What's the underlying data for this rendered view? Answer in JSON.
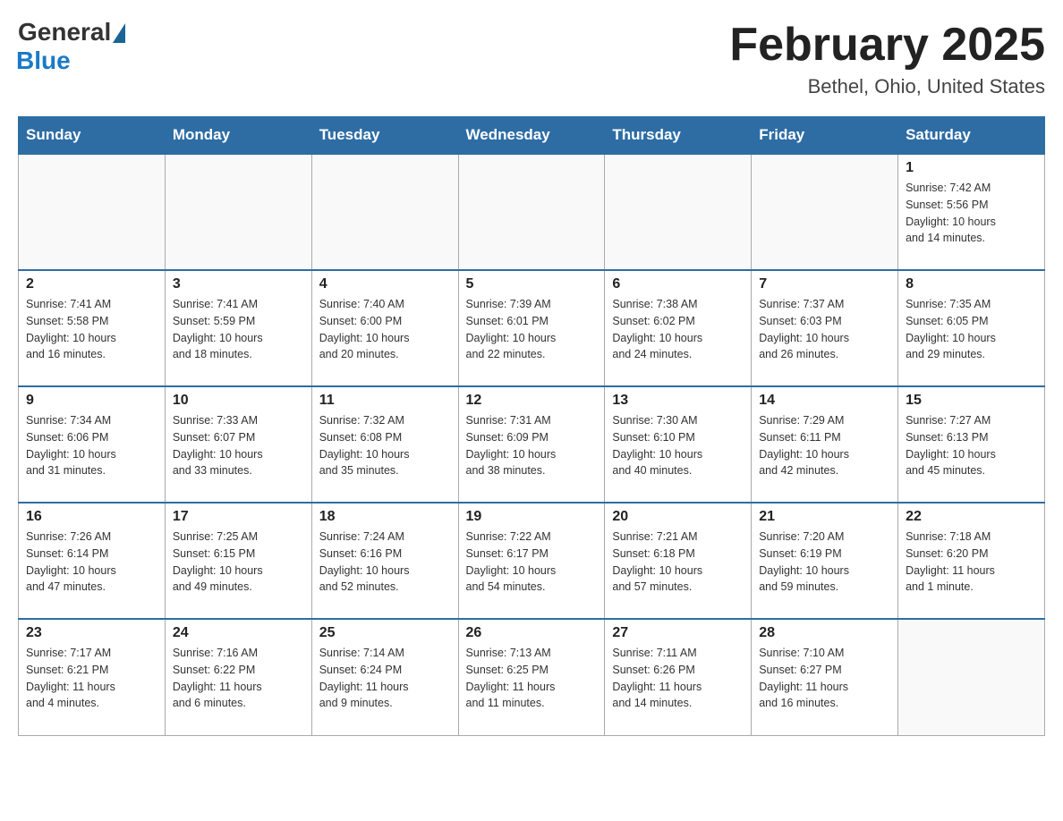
{
  "header": {
    "logo_general": "General",
    "logo_blue": "Blue",
    "month_title": "February 2025",
    "location": "Bethel, Ohio, United States"
  },
  "days_of_week": [
    "Sunday",
    "Monday",
    "Tuesday",
    "Wednesday",
    "Thursday",
    "Friday",
    "Saturday"
  ],
  "weeks": [
    [
      {
        "day": "",
        "info": ""
      },
      {
        "day": "",
        "info": ""
      },
      {
        "day": "",
        "info": ""
      },
      {
        "day": "",
        "info": ""
      },
      {
        "day": "",
        "info": ""
      },
      {
        "day": "",
        "info": ""
      },
      {
        "day": "1",
        "info": "Sunrise: 7:42 AM\nSunset: 5:56 PM\nDaylight: 10 hours\nand 14 minutes."
      }
    ],
    [
      {
        "day": "2",
        "info": "Sunrise: 7:41 AM\nSunset: 5:58 PM\nDaylight: 10 hours\nand 16 minutes."
      },
      {
        "day": "3",
        "info": "Sunrise: 7:41 AM\nSunset: 5:59 PM\nDaylight: 10 hours\nand 18 minutes."
      },
      {
        "day": "4",
        "info": "Sunrise: 7:40 AM\nSunset: 6:00 PM\nDaylight: 10 hours\nand 20 minutes."
      },
      {
        "day": "5",
        "info": "Sunrise: 7:39 AM\nSunset: 6:01 PM\nDaylight: 10 hours\nand 22 minutes."
      },
      {
        "day": "6",
        "info": "Sunrise: 7:38 AM\nSunset: 6:02 PM\nDaylight: 10 hours\nand 24 minutes."
      },
      {
        "day": "7",
        "info": "Sunrise: 7:37 AM\nSunset: 6:03 PM\nDaylight: 10 hours\nand 26 minutes."
      },
      {
        "day": "8",
        "info": "Sunrise: 7:35 AM\nSunset: 6:05 PM\nDaylight: 10 hours\nand 29 minutes."
      }
    ],
    [
      {
        "day": "9",
        "info": "Sunrise: 7:34 AM\nSunset: 6:06 PM\nDaylight: 10 hours\nand 31 minutes."
      },
      {
        "day": "10",
        "info": "Sunrise: 7:33 AM\nSunset: 6:07 PM\nDaylight: 10 hours\nand 33 minutes."
      },
      {
        "day": "11",
        "info": "Sunrise: 7:32 AM\nSunset: 6:08 PM\nDaylight: 10 hours\nand 35 minutes."
      },
      {
        "day": "12",
        "info": "Sunrise: 7:31 AM\nSunset: 6:09 PM\nDaylight: 10 hours\nand 38 minutes."
      },
      {
        "day": "13",
        "info": "Sunrise: 7:30 AM\nSunset: 6:10 PM\nDaylight: 10 hours\nand 40 minutes."
      },
      {
        "day": "14",
        "info": "Sunrise: 7:29 AM\nSunset: 6:11 PM\nDaylight: 10 hours\nand 42 minutes."
      },
      {
        "day": "15",
        "info": "Sunrise: 7:27 AM\nSunset: 6:13 PM\nDaylight: 10 hours\nand 45 minutes."
      }
    ],
    [
      {
        "day": "16",
        "info": "Sunrise: 7:26 AM\nSunset: 6:14 PM\nDaylight: 10 hours\nand 47 minutes."
      },
      {
        "day": "17",
        "info": "Sunrise: 7:25 AM\nSunset: 6:15 PM\nDaylight: 10 hours\nand 49 minutes."
      },
      {
        "day": "18",
        "info": "Sunrise: 7:24 AM\nSunset: 6:16 PM\nDaylight: 10 hours\nand 52 minutes."
      },
      {
        "day": "19",
        "info": "Sunrise: 7:22 AM\nSunset: 6:17 PM\nDaylight: 10 hours\nand 54 minutes."
      },
      {
        "day": "20",
        "info": "Sunrise: 7:21 AM\nSunset: 6:18 PM\nDaylight: 10 hours\nand 57 minutes."
      },
      {
        "day": "21",
        "info": "Sunrise: 7:20 AM\nSunset: 6:19 PM\nDaylight: 10 hours\nand 59 minutes."
      },
      {
        "day": "22",
        "info": "Sunrise: 7:18 AM\nSunset: 6:20 PM\nDaylight: 11 hours\nand 1 minute."
      }
    ],
    [
      {
        "day": "23",
        "info": "Sunrise: 7:17 AM\nSunset: 6:21 PM\nDaylight: 11 hours\nand 4 minutes."
      },
      {
        "day": "24",
        "info": "Sunrise: 7:16 AM\nSunset: 6:22 PM\nDaylight: 11 hours\nand 6 minutes."
      },
      {
        "day": "25",
        "info": "Sunrise: 7:14 AM\nSunset: 6:24 PM\nDaylight: 11 hours\nand 9 minutes."
      },
      {
        "day": "26",
        "info": "Sunrise: 7:13 AM\nSunset: 6:25 PM\nDaylight: 11 hours\nand 11 minutes."
      },
      {
        "day": "27",
        "info": "Sunrise: 7:11 AM\nSunset: 6:26 PM\nDaylight: 11 hours\nand 14 minutes."
      },
      {
        "day": "28",
        "info": "Sunrise: 7:10 AM\nSunset: 6:27 PM\nDaylight: 11 hours\nand 16 minutes."
      },
      {
        "day": "",
        "info": ""
      }
    ]
  ]
}
